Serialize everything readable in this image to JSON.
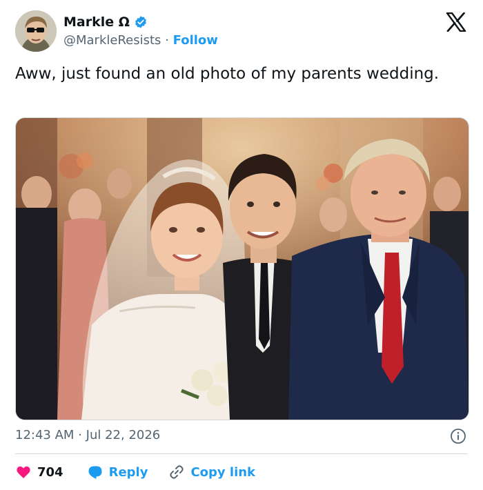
{
  "author": {
    "display_name": "Markle Ω",
    "handle": "@MarkleResists",
    "separator": "·",
    "follow_label": "Follow"
  },
  "tweet": {
    "text": "Aww, just found an old photo of my parents wedding."
  },
  "meta": {
    "time": "12:43 AM",
    "separator": "·",
    "date": "Jul 22, 2026"
  },
  "actions": {
    "like_count": "704",
    "reply_label": "Reply",
    "copy_label": "Copy link"
  },
  "icons": {
    "verified": "verified-badge-icon",
    "x_logo": "x-logo-icon",
    "info": "info-icon",
    "heart": "heart-icon",
    "reply": "reply-bubble-icon",
    "link": "link-icon"
  },
  "colors": {
    "accent": "#1d9bf0",
    "like": "#f91880",
    "text": "#0f1419",
    "muted": "#536471",
    "border": "#cfd9de"
  }
}
